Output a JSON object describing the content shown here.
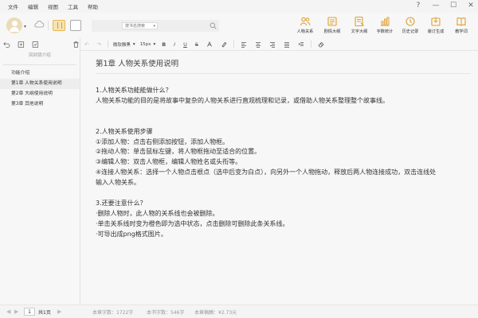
{
  "menu": {
    "items": [
      "文件",
      "编辑",
      "视图",
      "工具",
      "帮助"
    ]
  },
  "window_controls": {
    "help": "?",
    "minimize": "—",
    "maximize": "☐",
    "close": "✕"
  },
  "search": {
    "scope": "按书名搜索"
  },
  "toolbar": {
    "tools": [
      {
        "id": "character-relations",
        "label": "人物关系"
      },
      {
        "id": "story-outline",
        "label": "剧情大纲"
      },
      {
        "id": "text-outline",
        "label": "文字大纲"
      },
      {
        "id": "word-count",
        "label": "字数统计"
      },
      {
        "id": "history",
        "label": "历史记录"
      },
      {
        "id": "export",
        "label": "装订生成"
      },
      {
        "id": "tutorial",
        "label": "教学词"
      }
    ]
  },
  "sidebar": {
    "subtitle": "回到锁介绍",
    "items": [
      {
        "label": "功能介绍",
        "active": false
      },
      {
        "label": "第1章 人物关系使用说明",
        "active": true
      },
      {
        "label": "第2章 大纲使用说明",
        "active": false
      },
      {
        "label": "第3章 其他说明",
        "active": false
      }
    ]
  },
  "formatbar": {
    "font": "微软雅黑",
    "size": "15px",
    "bold": "B",
    "italic": "I",
    "underline": "U",
    "strike": "S"
  },
  "document": {
    "title": "第1章 人物关系使用说明",
    "paragraphs": [
      "1.人物关系功能能做什么？",
      "人物关系功能的目的是将故事中复杂的人物关系进行直观梳理和记录，或借助人物关系整理整个故事线。",
      "",
      "",
      "2.人物关系使用步骤",
      "①添加人物：点击右侧添加按钮，添加人物框。",
      "②拖动人物：单击鼠标左键，将人物框拖动至适合的位置。",
      "③编辑人物：双击人物框，编辑人物姓名或头衔等。",
      "④连接人物关系：选择一个人物点击根点（选中后变为白点），向另外一个人物拖动，释放后两人物连接成功，双击连线处",
      "输入人物关系。",
      "",
      "3.还要注意什么？",
      "·删除人物时，此人物的关系线也会被删除。",
      "·单击关系线时变为橙色即为选中状态，点击删除可删除此条关系线。",
      "·可导出成png格式图片。"
    ]
  },
  "status": {
    "page_input": "1",
    "page_total": "共1页",
    "chapter_words": "本章字数：1722字",
    "book_words": "本书字数：546字",
    "royalty": "本章稿酬：¥2.73元"
  },
  "colors": {
    "accent": "#e0a030",
    "background": "#f7f7f7"
  }
}
